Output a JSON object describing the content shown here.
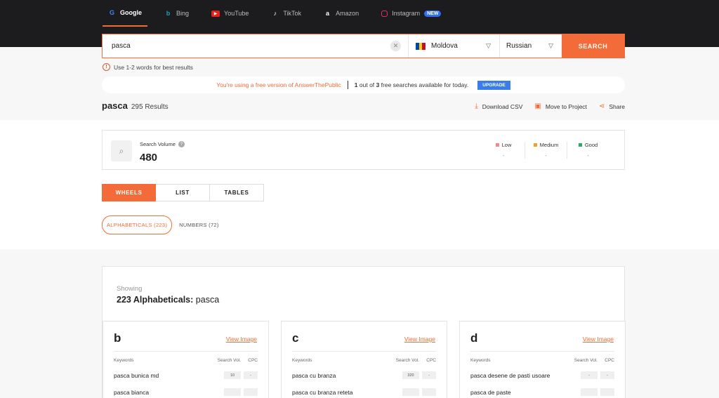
{
  "engines": [
    {
      "label": "Google",
      "icon": "google-icon",
      "active": true
    },
    {
      "label": "Bing",
      "icon": "bing-icon"
    },
    {
      "label": "YouTube",
      "icon": "youtube-icon"
    },
    {
      "label": "TikTok",
      "icon": "tiktok-icon"
    },
    {
      "label": "Amazon",
      "icon": "amazon-icon"
    },
    {
      "label": "Instagram",
      "icon": "instagram-icon",
      "badge": "NEW"
    }
  ],
  "search": {
    "query": "pasca",
    "country": "Moldova",
    "language": "Russian",
    "button": "SEARCH"
  },
  "hint": "Use 1-2 words for best results",
  "free_notice": {
    "left": "You're using a free version of AnswerThePublic",
    "used": "1",
    "mid1": "out of",
    "total": "3",
    "mid2": "free searches available for today.",
    "upgrade": "UPGRADE"
  },
  "results_header": {
    "keyword": "pasca",
    "count": "295 Results",
    "actions": [
      "Download CSV",
      "Move to Project",
      "Share"
    ]
  },
  "volume": {
    "label": "Search Volume",
    "value": "480",
    "legend": [
      {
        "label": "Low",
        "value": "-",
        "color": "#f08a8a"
      },
      {
        "label": "Medium",
        "value": "-",
        "color": "#f0a030"
      },
      {
        "label": "Good",
        "value": "-",
        "color": "#2ea866"
      }
    ]
  },
  "view_tabs": [
    "WHEELS",
    "LIST",
    "TABLES"
  ],
  "sub_tabs": [
    "ALPHABETICALS (223)",
    "NUMBERS (72)"
  ],
  "showing": {
    "label": "Showing",
    "count_label": "223 Alphabeticals:",
    "keyword": "pasca"
  },
  "columns": {
    "keywords": "Keywords",
    "volume": "Search Vol.",
    "cpc": "CPC"
  },
  "view_image": "View Image",
  "cards": [
    {
      "letter": "b",
      "rows": [
        {
          "kw": "pasca bunica md",
          "vol": "10",
          "cpc": "-"
        },
        {
          "kw": "pasca bianca",
          "vol": "",
          "cpc": ""
        }
      ]
    },
    {
      "letter": "c",
      "rows": [
        {
          "kw": "pasca cu branza",
          "vol": "320",
          "cpc": "-"
        },
        {
          "kw": "pasca cu branza reteta",
          "vol": "",
          "cpc": ""
        }
      ]
    },
    {
      "letter": "d",
      "rows": [
        {
          "kw": "pasca desene de pasti usoare",
          "vol": "-",
          "cpc": "-"
        },
        {
          "kw": "pasca de paste",
          "vol": "",
          "cpc": ""
        }
      ]
    }
  ]
}
